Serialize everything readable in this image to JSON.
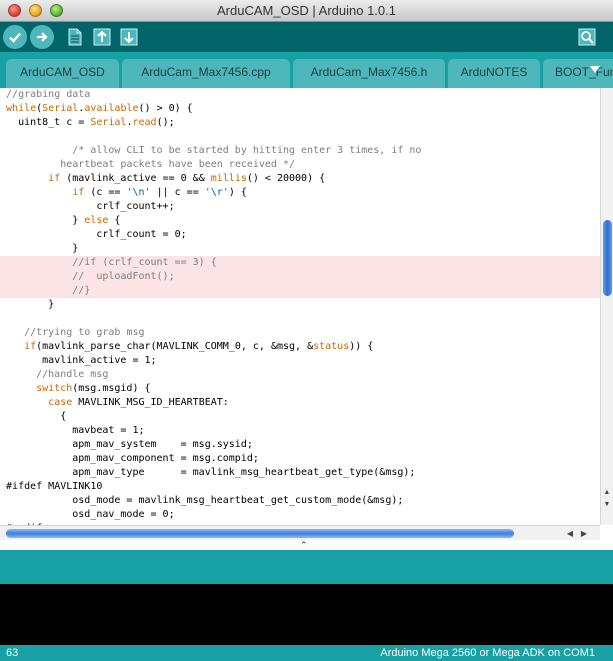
{
  "window": {
    "title": "ArduCAM_OSD | Arduino 1.0.1"
  },
  "toolbar": {
    "buttons": [
      {
        "name": "verify",
        "icon": "checkmark-icon"
      },
      {
        "name": "upload",
        "icon": "arrow-right-icon"
      },
      {
        "name": "new",
        "icon": "new-document-icon"
      },
      {
        "name": "open",
        "icon": "open-arrow-up-icon"
      },
      {
        "name": "save",
        "icon": "save-arrow-down-icon"
      },
      {
        "name": "serial-monitor",
        "icon": "magnifier-icon"
      }
    ]
  },
  "tabs": [
    {
      "label": "ArduCAM_OSD"
    },
    {
      "label": "ArduCam_Max7456.cpp"
    },
    {
      "label": "ArduCam_Max7456.h"
    },
    {
      "label": "ArduNOTES"
    },
    {
      "label": "BOOT_Func"
    }
  ],
  "code": [
    {
      "indent": "",
      "tokens": [
        {
          "t": "//grabing data",
          "c": "comment"
        }
      ]
    },
    {
      "indent": "",
      "tokens": [
        {
          "t": "while",
          "c": "kw"
        },
        {
          "t": "("
        },
        {
          "t": "Serial",
          "c": "kw"
        },
        {
          "t": "."
        },
        {
          "t": "available",
          "c": "kw"
        },
        {
          "t": "() > 0) {"
        }
      ]
    },
    {
      "indent": "  ",
      "tokens": [
        {
          "t": "uint8_t c = "
        },
        {
          "t": "Serial",
          "c": "kw"
        },
        {
          "t": "."
        },
        {
          "t": "read",
          "c": "kw"
        },
        {
          "t": "();"
        }
      ]
    },
    {
      "indent": "",
      "tokens": []
    },
    {
      "indent": "           ",
      "tokens": [
        {
          "t": "/* allow CLI to be started by hitting enter 3 times, if no",
          "c": "comment"
        }
      ]
    },
    {
      "indent": "         ",
      "tokens": [
        {
          "t": "heartbeat packets have been received */",
          "c": "comment"
        }
      ]
    },
    {
      "indent": "       ",
      "tokens": [
        {
          "t": "if",
          "c": "kw"
        },
        {
          "t": " (mavlink_active == 0 && "
        },
        {
          "t": "millis",
          "c": "kw"
        },
        {
          "t": "() < 20000) {"
        }
      ]
    },
    {
      "indent": "           ",
      "tokens": [
        {
          "t": "if",
          "c": "kw"
        },
        {
          "t": " (c == "
        },
        {
          "t": "'\\n'",
          "c": "str"
        },
        {
          "t": " || c == "
        },
        {
          "t": "'\\r'",
          "c": "str"
        },
        {
          "t": ") {"
        }
      ]
    },
    {
      "indent": "               ",
      "tokens": [
        {
          "t": "crlf_count++;"
        }
      ]
    },
    {
      "indent": "           ",
      "tokens": [
        {
          "t": "} "
        },
        {
          "t": "else",
          "c": "kw"
        },
        {
          "t": " {"
        }
      ]
    },
    {
      "indent": "               ",
      "tokens": [
        {
          "t": "crlf_count = 0;"
        }
      ]
    },
    {
      "indent": "           ",
      "tokens": [
        {
          "t": "}"
        }
      ]
    },
    {
      "indent": "           ",
      "hl": true,
      "tokens": [
        {
          "t": "//if (crlf_count == 3) {",
          "c": "comment"
        }
      ]
    },
    {
      "indent": "           ",
      "hl": true,
      "tokens": [
        {
          "t": "//  uploadFont();",
          "c": "comment"
        }
      ]
    },
    {
      "indent": "           ",
      "hl": true,
      "tokens": [
        {
          "t": "//}",
          "c": "comment"
        }
      ]
    },
    {
      "indent": "       ",
      "tokens": [
        {
          "t": "}"
        }
      ]
    },
    {
      "indent": "",
      "tokens": []
    },
    {
      "indent": "   ",
      "tokens": [
        {
          "t": "//trying to grab msg",
          "c": "comment"
        }
      ]
    },
    {
      "indent": "   ",
      "tokens": [
        {
          "t": "if",
          "c": "kw"
        },
        {
          "t": "(mavlink_parse_char(MAVLINK_COMM_0, c, &msg, &"
        },
        {
          "t": "status",
          "c": "kw"
        },
        {
          "t": ")) {"
        }
      ]
    },
    {
      "indent": "      ",
      "tokens": [
        {
          "t": "mavlink_active = 1;"
        }
      ]
    },
    {
      "indent": "     ",
      "tokens": [
        {
          "t": "//handle msg",
          "c": "comment"
        }
      ]
    },
    {
      "indent": "     ",
      "tokens": [
        {
          "t": "switch",
          "c": "kw"
        },
        {
          "t": "(msg.msgid) {"
        }
      ]
    },
    {
      "indent": "       ",
      "tokens": [
        {
          "t": "case",
          "c": "kw"
        },
        {
          "t": " MAVLINK_MSG_ID_HEARTBEAT:"
        }
      ]
    },
    {
      "indent": "         ",
      "tokens": [
        {
          "t": "{"
        }
      ]
    },
    {
      "indent": "           ",
      "tokens": [
        {
          "t": "mavbeat = 1;"
        }
      ]
    },
    {
      "indent": "           ",
      "tokens": [
        {
          "t": "apm_mav_system    = msg.sysid;"
        }
      ]
    },
    {
      "indent": "           ",
      "tokens": [
        {
          "t": "apm_mav_component = msg.compid;"
        }
      ]
    },
    {
      "indent": "           ",
      "tokens": [
        {
          "t": "apm_mav_type      = mavlink_msg_heartbeat_get_type(&msg);"
        }
      ]
    },
    {
      "indent": "",
      "tokens": [
        {
          "t": "#ifdef MAVLINK10"
        }
      ]
    },
    {
      "indent": "           ",
      "tokens": [
        {
          "t": "osd_mode = mavlink_msg_heartbeat_get_custom_mode(&msg);"
        }
      ]
    },
    {
      "indent": "           ",
      "tokens": [
        {
          "t": "osd_nav_mode = 0;"
        }
      ]
    },
    {
      "indent": "",
      "tokens": [
        {
          "t": "#endif"
        }
      ]
    }
  ],
  "status": {
    "line_number": "63",
    "board": "Arduino Mega 2560 or Mega ADK on COM1"
  },
  "colors": {
    "toolbar": "#006468",
    "tabbar": "#17a1a5",
    "tab": "#4db7bb",
    "highlight": "#fde4e4",
    "keyword": "#cc6600",
    "comment": "#7e7e7e",
    "string": "#006699"
  }
}
